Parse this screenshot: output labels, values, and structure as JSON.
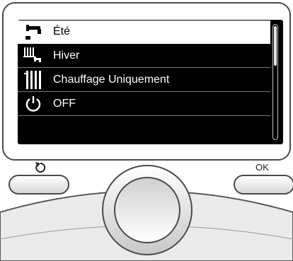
{
  "menu": {
    "items": [
      {
        "label": "Été",
        "icon": "tap-icon",
        "selected": true
      },
      {
        "label": "Hiver",
        "icon": "radiator-tap-icon",
        "selected": false
      },
      {
        "label": "Chauffage Uniquement",
        "icon": "radiator-icon",
        "selected": false
      },
      {
        "label": "OFF",
        "icon": "power-icon",
        "selected": false
      }
    ]
  },
  "buttons": {
    "back_icon": "back-arrow-icon",
    "ok_label": "OK"
  },
  "colors": {
    "screen": "#000000",
    "selected_bg": "#ffffff",
    "frame": "#4a4a4a"
  }
}
